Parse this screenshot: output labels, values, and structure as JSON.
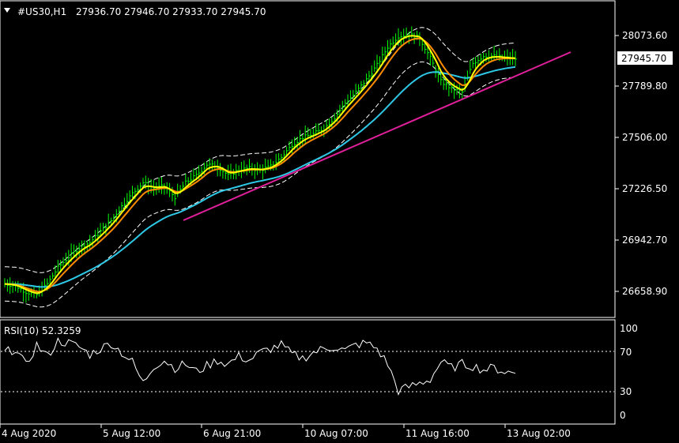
{
  "header": {
    "menu_icon": "triangle-down-icon",
    "symbol": "#US30,H1",
    "ohlc": "27936.70 27946.70 27933.70 27945.70"
  },
  "price_axis": {
    "ticks": [
      "28073.60",
      "27789.80",
      "27506.00",
      "27226.50",
      "26942.70",
      "26658.90"
    ],
    "current_price_label": "27945.70"
  },
  "rsi": {
    "label": "RSI(10) 52.3259",
    "ticks": [
      "100",
      "70",
      "30",
      "0"
    ],
    "levels": [
      70,
      30
    ]
  },
  "time_axis": {
    "ticks": [
      "4 Aug 2020",
      "5 Aug 12:00",
      "6 Aug 21:00",
      "10 Aug 07:00",
      "11 Aug 16:00",
      "13 Aug 02:00"
    ]
  },
  "colors": {
    "background": "#000000",
    "frame": "#ffffff",
    "candles": "#00ff00",
    "ma_fast": "#ffff00",
    "ma_mid": "#ff8c00",
    "ma_slow": "#2ec8e6",
    "trendline": "#e0209a",
    "bands": "#ffffff",
    "rsi_line": "#ffffff"
  },
  "chart_data": [
    {
      "type": "line",
      "title": "#US30,H1",
      "series": [
        {
          "values": [
            26700,
            26690,
            26655,
            26640,
            26700,
            26790,
            26850,
            26900,
            26930,
            26990,
            27050,
            27130,
            27200,
            27260,
            27230,
            27240,
            27180,
            27260,
            27300,
            27360,
            27350,
            27300,
            27330,
            27340,
            27330,
            27350,
            27400,
            27470,
            27510,
            27530,
            27560,
            27620,
            27700,
            27760,
            27830,
            27910,
            28010,
            28070,
            28080,
            28060,
            27950,
            27820,
            27780,
            27760,
            27920,
            27960,
            27960,
            27950,
            27945.7
          ]
        }
      ],
      "ylim": [
        26550,
        28240
      ],
      "ylabel": "",
      "xlabel": ""
    },
    {
      "type": "line",
      "title": "RSI(10) 52.3259",
      "series": [
        {
          "name": "RSI(10)",
          "values": [
            74,
            78,
            60,
            82,
            70,
            86,
            84,
            80,
            72,
            78,
            84,
            74,
            64,
            42,
            60,
            66,
            58,
            62,
            54,
            60,
            66,
            62,
            70,
            66,
            74,
            78,
            82,
            72,
            68,
            74,
            78,
            80,
            76,
            82,
            84,
            78,
            62,
            34,
            38,
            42,
            46,
            64,
            58,
            62,
            60,
            56,
            58,
            54,
            52.33
          ]
        }
      ],
      "ylim": [
        0,
        100
      ],
      "levels": [
        70,
        30
      ]
    }
  ]
}
